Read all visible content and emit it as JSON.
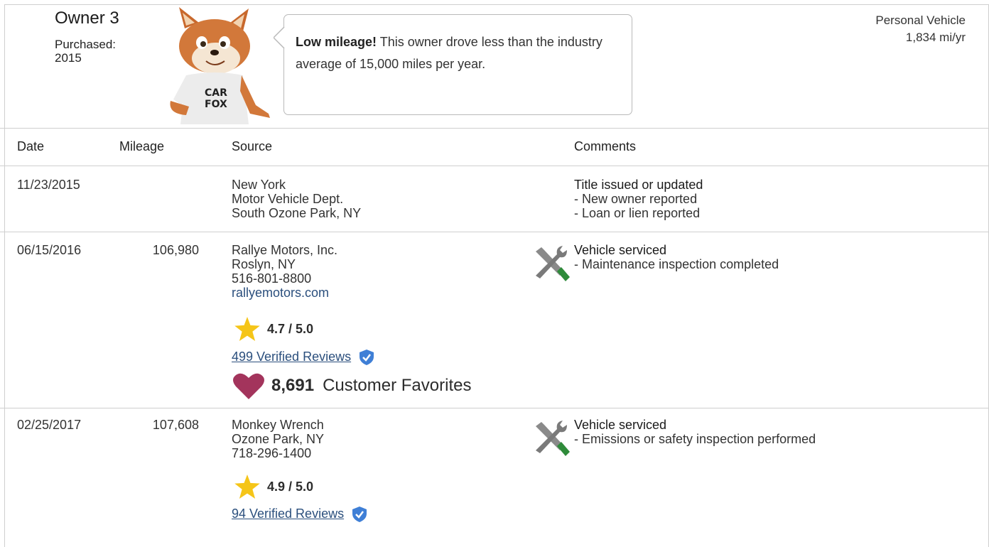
{
  "owner": {
    "title": "Owner 3",
    "purchased_label": "Purchased:",
    "purchased_year": "2015"
  },
  "bubble": {
    "bold": "Low mileage!",
    "text": " This owner drove less than the industry average of 15,000 miles per year."
  },
  "vehicle": {
    "type": "Personal Vehicle",
    "miles_per_year": "1,834 mi/yr"
  },
  "columns": {
    "date": "Date",
    "mileage": "Mileage",
    "source": "Source",
    "comments": "Comments"
  },
  "rows": [
    {
      "date": "11/23/2015",
      "mileage": "",
      "source": [
        "New York",
        "Motor Vehicle Dept.",
        "South Ozone Park, NY"
      ],
      "comment_title": "Title issued or updated",
      "comment_lines": [
        "- New owner reported",
        "- Loan or lien reported"
      ]
    },
    {
      "date": "06/15/2016",
      "mileage": "106,980",
      "source": [
        "Rallye Motors, Inc.",
        "Roslyn, NY",
        "516-801-8800"
      ],
      "website": "rallyemotors.com",
      "rating": "4.7 / 5.0",
      "reviews": "499 Verified Reviews",
      "favorites_count": "8,691",
      "favorites_label": "Customer Favorites",
      "comment_title": "Vehicle serviced",
      "comment_lines": [
        "- Maintenance inspection completed"
      ]
    },
    {
      "date": "02/25/2017",
      "mileage": "107,608",
      "source": [
        "Monkey Wrench",
        "Ozone Park, NY",
        "718-296-1400"
      ],
      "rating": "4.9 / 5.0",
      "reviews": "94 Verified Reviews",
      "comment_title": "Vehicle serviced",
      "comment_lines": [
        "- Emissions or safety inspection performed"
      ]
    }
  ],
  "colors": {
    "link": "#2b4f7d",
    "star": "#f5c518",
    "heart": "#a3345c",
    "verified": "#3f7fd6",
    "wrench_green": "#2e8b3a"
  },
  "icons": [
    "carfox-mascot",
    "star-icon",
    "heart-icon",
    "verified-shield-icon",
    "tools-icon"
  ]
}
